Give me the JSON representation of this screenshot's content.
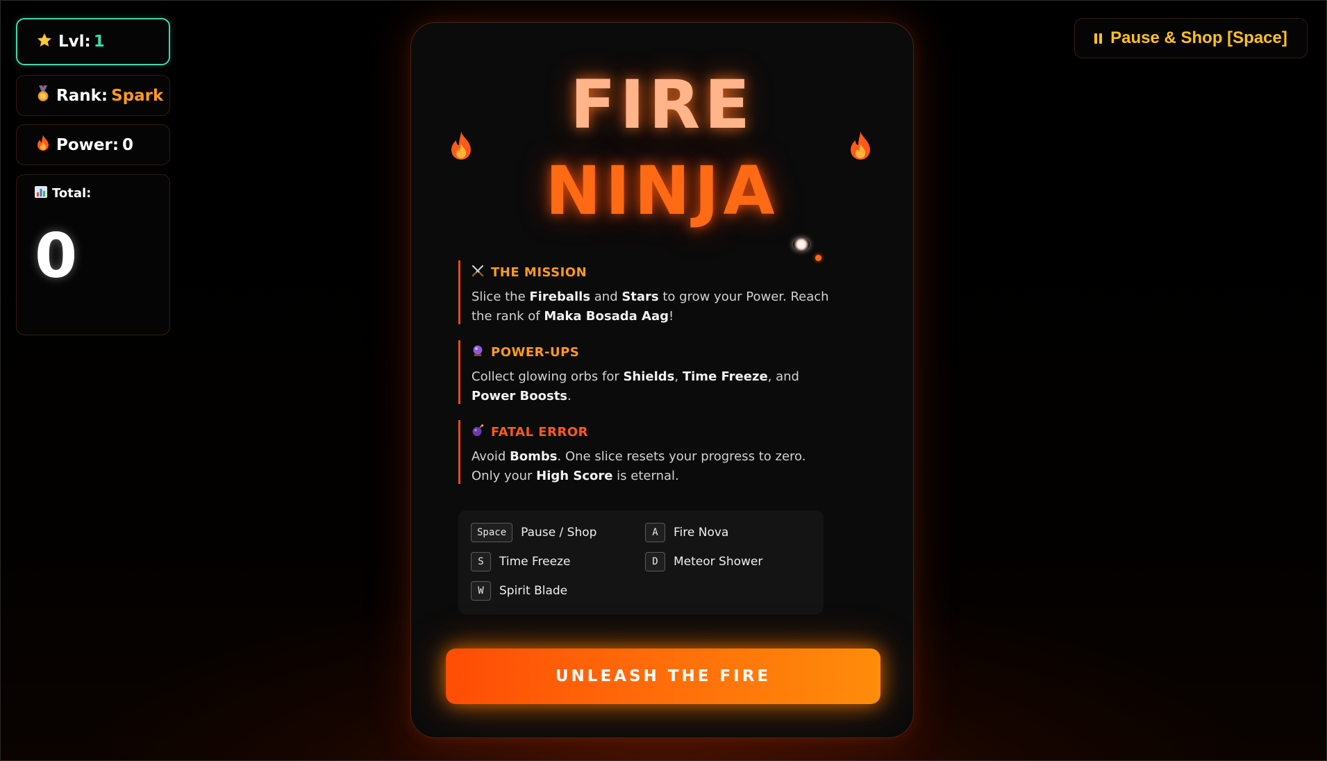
{
  "hud": {
    "level_label": "Lvl:",
    "level_value": "1",
    "level_icon": "star-icon",
    "rank_label": "Rank:",
    "rank_value": "Spark",
    "rank_icon": "medal-icon",
    "power_label": "Power:",
    "power_value": "0",
    "power_icon": "fire-icon",
    "total_label": "Total:",
    "total_value": "0",
    "total_icon": "chart-icon"
  },
  "pause_button": {
    "label": "Pause & Shop [Space]",
    "icon": "pause-icon",
    "color": "#ffc21a"
  },
  "title": {
    "line1": "FIRE",
    "line2": "NINJA",
    "line1_color": "#ffb48a",
    "line2_color": "#ff6a14"
  },
  "sections": {
    "mission": {
      "icon": "crossed-swords-icon",
      "heading": "THE MISSION",
      "body": [
        {
          "t": "Slice the "
        },
        {
          "t": "Fireballs",
          "b": true
        },
        {
          "t": " and "
        },
        {
          "t": "Stars",
          "b": true
        },
        {
          "t": " to grow your Power. Reach the rank of "
        },
        {
          "t": "Maka Bosada Aag",
          "b": true
        },
        {
          "t": "!"
        }
      ]
    },
    "powerups": {
      "icon": "crystal-ball-icon",
      "heading": "POWER-UPS",
      "body": [
        {
          "t": "Collect glowing orbs for "
        },
        {
          "t": "Shields",
          "b": true
        },
        {
          "t": ", "
        },
        {
          "t": "Time Freeze",
          "b": true
        },
        {
          "t": ", and "
        },
        {
          "t": "Power Boosts",
          "b": true
        },
        {
          "t": "."
        }
      ]
    },
    "fatal": {
      "icon": "bomb-icon",
      "heading": "FATAL ERROR",
      "body": [
        {
          "t": "Avoid "
        },
        {
          "t": "Bombs",
          "b": true
        },
        {
          "t": ". One slice resets your progress to zero. Only your "
        },
        {
          "t": "High Score",
          "b": true
        },
        {
          "t": " is eternal."
        }
      ]
    }
  },
  "controls": [
    {
      "key": "Space",
      "action": "Pause / Shop"
    },
    {
      "key": "A",
      "action": "Fire Nova"
    },
    {
      "key": "S",
      "action": "Time Freeze"
    },
    {
      "key": "D",
      "action": "Meteor Shower"
    },
    {
      "key": "W",
      "action": "Spirit Blade"
    }
  ],
  "cta": {
    "label": "UNLEASH THE FIRE"
  },
  "colors": {
    "accent_orange": "#ff6a14",
    "accent_teal": "#3fd9b0",
    "accent_gold": "#ffc21a",
    "section_border": "#e8491a"
  }
}
